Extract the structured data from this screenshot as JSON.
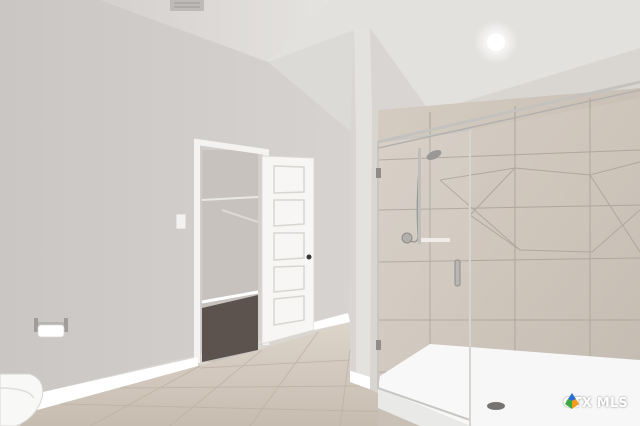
{
  "photo": {
    "subject": "bathroom-with-walk-in-closet-and-glass-shower"
  },
  "watermark": {
    "text": "CTX MLS",
    "colors": {
      "text": "#ffffff",
      "blue": "#2b6fd6",
      "green": "#3caa3c",
      "orange": "#f29b1d"
    }
  },
  "palette": {
    "wall": "#cfccc9",
    "ceiling": "#dfddda",
    "floor": "#d2c8bc",
    "trim": "#ffffff",
    "shower_tile": "#cbc2b8",
    "closet_carpet": "#5c534f"
  }
}
